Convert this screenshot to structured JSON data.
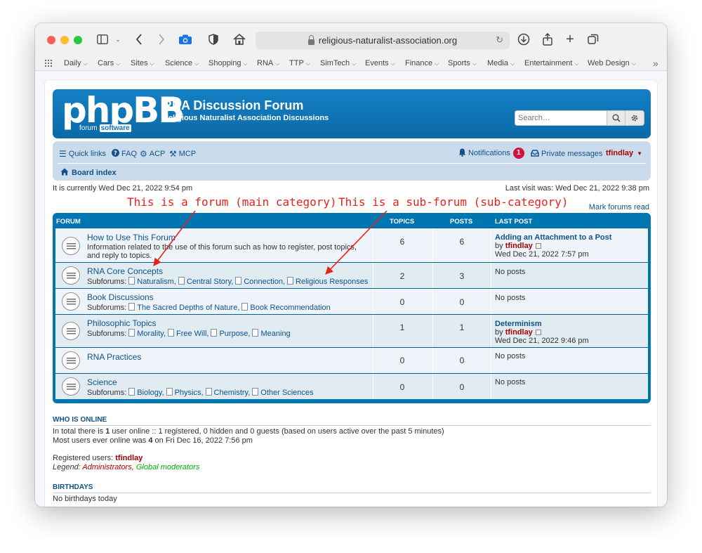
{
  "browser": {
    "url": "religious-naturalist-association.org",
    "bookmarks": [
      "Daily",
      "Cars",
      "Sites",
      "Science",
      "Shopping",
      "RNA",
      "TTP",
      "SimTech",
      "Events",
      "Finance",
      "Sports",
      "Media",
      "Entertainment",
      "Web Design"
    ]
  },
  "header": {
    "logo": "phpBB",
    "logo_sub1": "forum",
    "logo_sub2": "software",
    "title": "RNA Discussion Forum",
    "description": "Religious Naturalist Association Discussions",
    "search_placeholder": "Search…"
  },
  "nav": {
    "quick_links": "Quick links",
    "faq": "FAQ",
    "acp": "ACP",
    "mcp": "MCP",
    "notifications": "Notifications",
    "notifications_count": "1",
    "private_messages": "Private messages",
    "username": "tfindlay",
    "board_index": "Board index"
  },
  "info": {
    "current_time": "It is currently Wed Dec 21, 2022 9:54 pm",
    "last_visit": "Last visit was: Wed Dec 21, 2022 9:38 pm",
    "mark_read": "Mark forums read"
  },
  "annotations": {
    "forum": "This is a forum (main category)",
    "subforum": "This is a sub-forum (sub-category)"
  },
  "table": {
    "col_forum": "Forum",
    "col_topics": "Topics",
    "col_posts": "Posts",
    "col_last_post": "Last post",
    "subforums_label": "Subforums:",
    "by_label": "by",
    "no_posts": "No posts",
    "rows": [
      {
        "name": "How to Use This Forum",
        "description": "Information related to the use of this forum such as how to register, post topics, and reply to topics.",
        "topics": "6",
        "posts": "6",
        "last_post_title": "Adding an Attachment to a Post",
        "last_post_user": "tfindlay",
        "last_post_date": "Wed Dec 21, 2022 7:57 pm"
      },
      {
        "name": "RNA Core Concepts",
        "subforums": [
          "Naturalism,",
          "Central Story,",
          "Connection,",
          "Religious Responses"
        ],
        "topics": "2",
        "posts": "3"
      },
      {
        "name": "Book Discussions",
        "subforums": [
          "The Sacred Depths of Nature,",
          "Book Recommendation"
        ],
        "topics": "0",
        "posts": "0"
      },
      {
        "name": "Philosophic Topics",
        "subforums": [
          "Morality,",
          "Free Will,",
          "Purpose,",
          "Meaning"
        ],
        "topics": "1",
        "posts": "1",
        "last_post_title": "Determinism",
        "last_post_user": "tfindlay",
        "last_post_date": "Wed Dec 21, 2022 9:46 pm"
      },
      {
        "name": "RNA Practices",
        "topics": "0",
        "posts": "0"
      },
      {
        "name": "Science",
        "subforums": [
          "Biology,",
          "Physics,",
          "Chemistry,",
          "Other Sciences"
        ],
        "topics": "0",
        "posts": "0"
      }
    ]
  },
  "online": {
    "title": "Who is online",
    "line1_a": "In total there is ",
    "line1_b": "1",
    "line1_c": " user online :: 1 registered, 0 hidden and 0 guests (based on users active over the past 5 minutes)",
    "line2_a": "Most users ever online was ",
    "line2_b": "4",
    "line2_c": " on Fri Dec 16, 2022 7:56 pm",
    "registered_label": "Registered users: ",
    "registered_user": "tfindlay",
    "legend_label": "Legend: ",
    "legend_admins": "Administrators",
    "legend_sep": ", ",
    "legend_gmods": "Global moderators"
  },
  "birthdays": {
    "title": "Birthdays",
    "text": "No birthdays today"
  },
  "colors": {
    "header_blue": "#0e75b6",
    "navbar_bg": "#cadceb",
    "link": "#105289",
    "username_red": "#aa0000",
    "annotation_red": "#e5231b"
  }
}
